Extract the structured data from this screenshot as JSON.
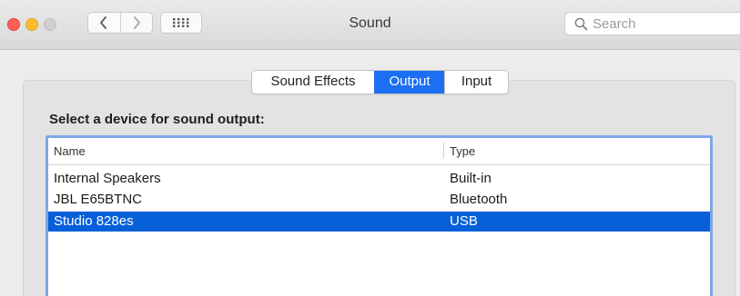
{
  "window": {
    "title": "Sound"
  },
  "toolbar": {
    "back_icon": "chevron-left-icon",
    "forward_icon": "chevron-right-icon",
    "show_all_icon": "grid-icon"
  },
  "search": {
    "placeholder": "Search",
    "value": ""
  },
  "tabs": [
    {
      "label": "Sound Effects",
      "active": false
    },
    {
      "label": "Output",
      "active": true
    },
    {
      "label": "Input",
      "active": false
    }
  ],
  "output": {
    "heading": "Select a device for sound output:",
    "columns": [
      "Name",
      "Type"
    ],
    "devices": [
      {
        "name": "Internal Speakers",
        "type": "Built-in",
        "selected": false
      },
      {
        "name": "JBL E65BTNC",
        "type": "Bluetooth",
        "selected": false
      },
      {
        "name": "Studio 828es",
        "type": "USB",
        "selected": true
      }
    ]
  },
  "colors": {
    "accent": "#1d6ff2",
    "selection": "#0860d8",
    "close": "#fe5f57",
    "minimize": "#febc2e",
    "zoom_disabled": "#cfcfcf"
  }
}
